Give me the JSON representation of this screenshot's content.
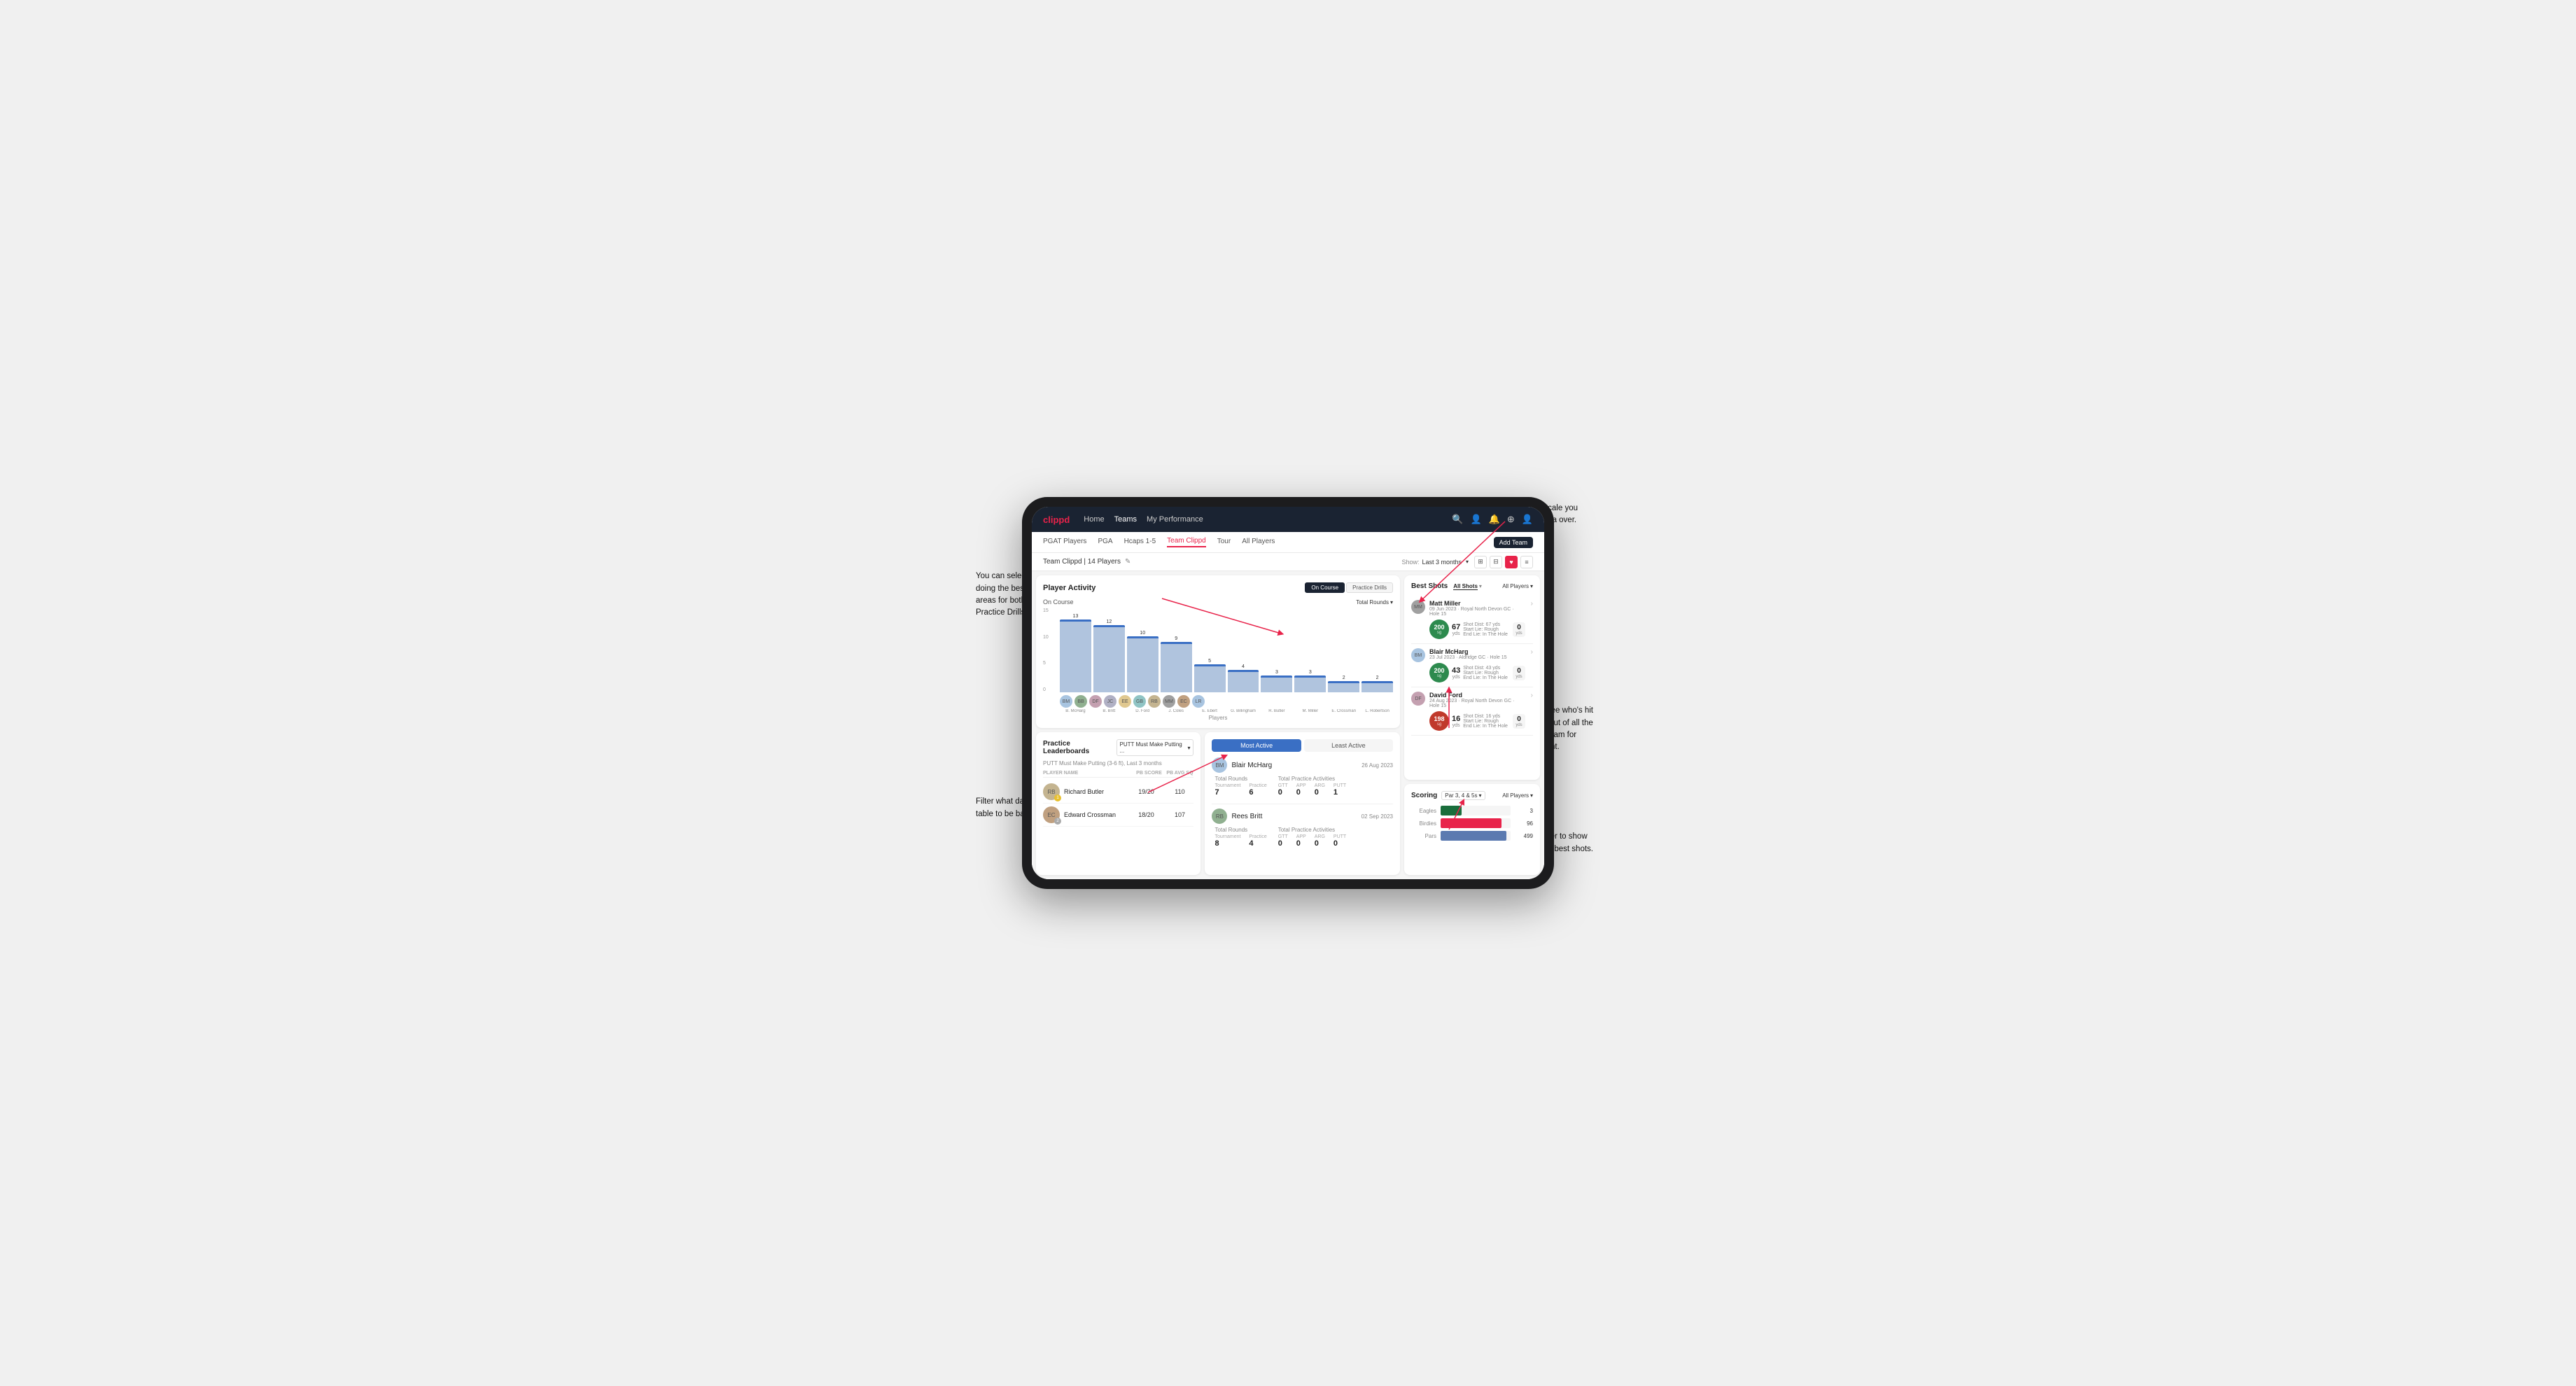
{
  "app": {
    "logo": "clippd",
    "nav": {
      "items": [
        "Home",
        "Teams",
        "My Performance"
      ],
      "active": "Teams",
      "icons": [
        "🔍",
        "👤",
        "🔔",
        "⊕",
        "👤"
      ]
    },
    "sub_nav": {
      "items": [
        "PGAT Players",
        "PGA",
        "Hcaps 1-5",
        "Team Clippd",
        "Tour",
        "All Players"
      ],
      "active": "Team Clippd",
      "add_btn": "Add Team"
    },
    "team_header": {
      "title": "Team Clippd | 14 Players",
      "show_label": "Show:",
      "show_value": "Last 3 months",
      "view_icons": [
        "⊞",
        "⊟",
        "♥",
        "≡"
      ]
    }
  },
  "player_activity": {
    "title": "Player Activity",
    "section": "On Course",
    "toggles": [
      "On Course",
      "Practice Drills"
    ],
    "active_toggle": "On Course",
    "dropdown": "Total Rounds",
    "y_labels": [
      "15",
      "10",
      "5",
      "0"
    ],
    "y_title": "Total Rounds",
    "bars": [
      {
        "player": "B. McHarg",
        "value": 13
      },
      {
        "player": "B. Britt",
        "value": 12
      },
      {
        "player": "D. Ford",
        "value": 10
      },
      {
        "player": "J. Coles",
        "value": 9
      },
      {
        "player": "E. Ebert",
        "value": 5
      },
      {
        "player": "G. Billingham",
        "value": 4
      },
      {
        "player": "R. Butler",
        "value": 3
      },
      {
        "player": "M. Miller",
        "value": 3
      },
      {
        "player": "E. Crossman",
        "value": 2
      },
      {
        "player": "L. Robertson",
        "value": 2
      }
    ],
    "x_title": "Players"
  },
  "practice_leaderboards": {
    "title": "Practice Leaderboards",
    "dropdown": "PUTT Must Make Putting ...",
    "subtitle": "PUTT Must Make Putting (3-6 ft), Last 3 months",
    "columns": [
      "PLAYER NAME",
      "PB SCORE",
      "PB AVG SQ"
    ],
    "players": [
      {
        "name": "Richard Butler",
        "rank": 1,
        "pb_score": "19/20",
        "pb_avg": "110"
      },
      {
        "name": "Edward Crossman",
        "rank": 2,
        "pb_score": "18/20",
        "pb_avg": "107"
      }
    ]
  },
  "most_active": {
    "tabs": [
      "Most Active",
      "Least Active"
    ],
    "active_tab": "Most Active",
    "players": [
      {
        "name": "Blair McHarg",
        "date": "26 Aug 2023",
        "total_rounds_label": "Total Rounds",
        "total_practice_label": "Total Practice Activities",
        "rounds_cols": [
          "Tournament",
          "Practice"
        ],
        "rounds_vals": [
          "7",
          "6"
        ],
        "practice_cols": [
          "GTT",
          "APP",
          "ARG",
          "PUTT"
        ],
        "practice_vals": [
          "0",
          "0",
          "0",
          "1"
        ]
      },
      {
        "name": "Rees Britt",
        "date": "02 Sep 2023",
        "total_rounds_label": "Total Rounds",
        "total_practice_label": "Total Practice Activities",
        "rounds_cols": [
          "Tournament",
          "Practice"
        ],
        "rounds_vals": [
          "8",
          "4"
        ],
        "practice_cols": [
          "GTT",
          "APP",
          "ARG",
          "PUTT"
        ],
        "practice_vals": [
          "0",
          "0",
          "0",
          "0"
        ]
      }
    ]
  },
  "best_shots": {
    "title": "Best Shots",
    "filters": [
      "All Shots",
      "All Players"
    ],
    "shots_tabs": [
      "All Shots",
      "Best Shots"
    ],
    "active_shots": "All Shots",
    "all_players_label": "All Players",
    "players": [
      {
        "name": "Matt Miller",
        "date": "09 Jun 2023",
        "course": "Royal North Devon GC",
        "hole": "Hole 15",
        "sg": "200",
        "shot_dist": "67",
        "unit": "yds",
        "start_lie": "Rough",
        "end_lie": "In The Hole",
        "result_val": "0",
        "result_unit": "yds",
        "badge_color": "green"
      },
      {
        "name": "Blair McHarg",
        "date": "23 Jul 2023",
        "course": "Aldridge GC",
        "hole": "Hole 15",
        "sg": "200",
        "shot_dist": "43",
        "unit": "yds",
        "start_lie": "Rough",
        "end_lie": "In The Hole",
        "result_val": "0",
        "result_unit": "yds",
        "badge_color": "green"
      },
      {
        "name": "David Ford",
        "date": "24 Aug 2023",
        "course": "Royal North Devon GC",
        "hole": "Hole 15",
        "sg": "198",
        "shot_dist": "16",
        "unit": "yds",
        "start_lie": "Rough",
        "end_lie": "In The Hole",
        "result_val": "0",
        "result_unit": "yds",
        "badge_color": "red"
      }
    ]
  },
  "scoring": {
    "title": "Scoring",
    "filter": "Par 3, 4 & 5s",
    "all_players": "All Players",
    "rows": [
      {
        "label": "Eagles",
        "value": 3,
        "max": 10,
        "color": "#1a6e3c"
      },
      {
        "label": "Birdies",
        "value": 96,
        "max": 110,
        "color": "#e8234a"
      },
      {
        "label": "Pars",
        "value": 499,
        "max": 530,
        "color": "#5b7ab0"
      }
    ]
  },
  "annotations": {
    "top_right": "Choose the timescale you\nwish to see the data over.",
    "left_top": "You can select which player is\ndoing the best in a range of\nareas for both On Course and\nPractice Drills.",
    "left_bottom": "Filter what data you wish the\ntable to be based on.",
    "right_middle": "Here you can see who's hit\nthe best shots out of all the\nplayers in the team for\neach department.",
    "right_lower": "You can also filter to show\njust one player's best shots."
  }
}
